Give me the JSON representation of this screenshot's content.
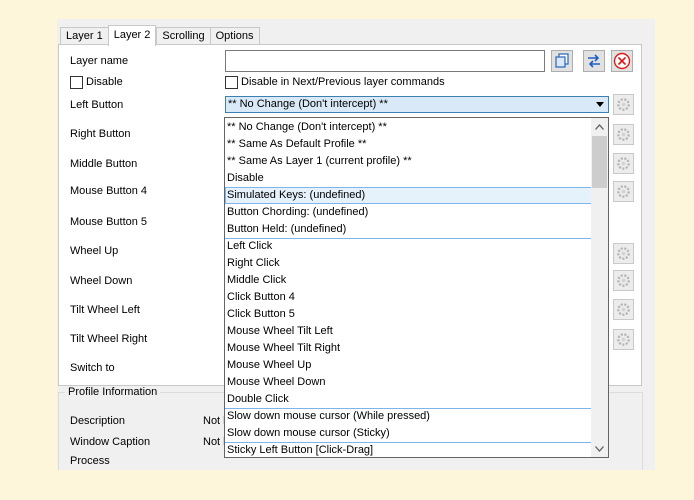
{
  "tabs": [
    "Layer 1",
    "Layer 2",
    "Scrolling",
    "Options"
  ],
  "layer_name_label": "Layer name",
  "layer_name_value": "",
  "disable_label": "Disable",
  "disable_next_prev_label": "Disable in Next/Previous layer commands",
  "buttons": {
    "left": "Left Button",
    "right": "Right Button",
    "middle": "Middle Button",
    "mb4": "Mouse Button 4",
    "mb5": "Mouse Button 5",
    "wheel_up": "Wheel Up",
    "wheel_down": "Wheel Down",
    "tilt_left": "Tilt Wheel Left",
    "tilt_right": "Tilt Wheel Right",
    "switch_to": "Switch to"
  },
  "left_button_combo_value": "** No Change (Don't intercept) **",
  "dropdown_items": [
    "** No Change (Don't intercept) **",
    "** Same As Default Profile **",
    "** Same As Layer 1 (current profile) **",
    "Disable",
    "Simulated Keys: (undefined)",
    "Button Chording: (undefined)",
    "Button Held: (undefined)",
    "Left Click",
    "Right Click",
    "Middle Click",
    "Click Button 4",
    "Click Button 5",
    "Mouse Wheel Tilt Left",
    "Mouse Wheel Tilt Right",
    "Mouse Wheel Up",
    "Mouse Wheel Down",
    "Double Click",
    "Slow down mouse cursor (While pressed)",
    "Slow down mouse cursor (Sticky)",
    "Sticky Left Button [Click-Drag]"
  ],
  "profile_info": {
    "title": "Profile Information",
    "description_label": "Description",
    "description_value": "Not l",
    "window_caption_label": "Window Caption",
    "window_caption_value": "Not l",
    "process_label": "Process"
  },
  "colors": {
    "background": "#fdf6da",
    "dialog": "#f0f0f0",
    "highlight": "#e5f1fb",
    "highlight_border": "#7eb4ea",
    "combo_selected": "#d9e9f7"
  },
  "icons": [
    "copy-icon",
    "swap-arrows-icon",
    "delete-icon",
    "gear-icon",
    "dropdown-arrow-icon",
    "scroll-up-icon",
    "scroll-down-icon"
  ]
}
